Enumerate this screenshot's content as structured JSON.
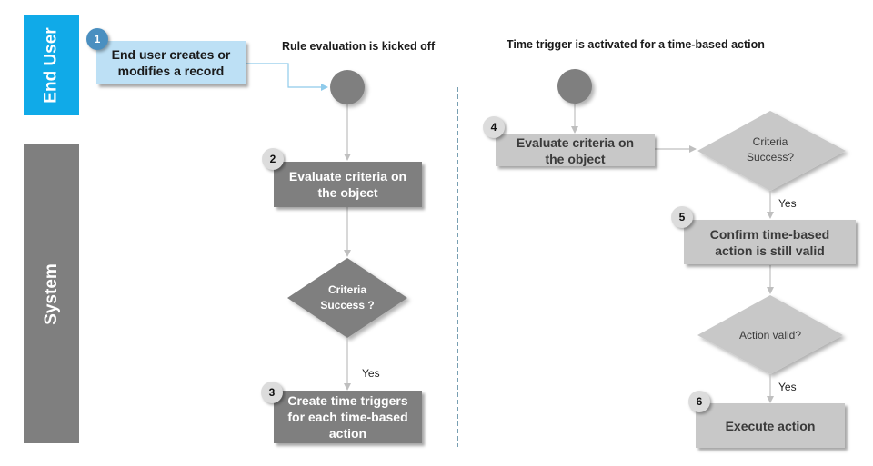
{
  "lanes": {
    "end_user": "End User",
    "system": "System"
  },
  "sections": {
    "left_title": "Rule evaluation is kicked off",
    "right_title": "Time trigger is activated for a time-based action"
  },
  "steps": [
    {
      "number": "1",
      "label": "End user creates or modifies a record"
    },
    {
      "number": "2",
      "label": "Evaluate criteria on the object"
    },
    {
      "number": "3",
      "label": "Create time triggers for each time-based action"
    },
    {
      "number": "4",
      "label": "Evaluate criteria on the object"
    },
    {
      "number": "5",
      "label": "Confirm time-based action is still valid"
    },
    {
      "number": "6",
      "label": "Execute action"
    }
  ],
  "decisions": {
    "left_criteria": "Criteria Success ?",
    "right_criteria": "Criteria Success?",
    "action_valid": "Action valid?"
  },
  "edge_labels": {
    "yes_left": "Yes",
    "yes_right_1": "Yes",
    "yes_right_2": "Yes"
  },
  "colors": {
    "end_user_lane": "#10aae8",
    "system_lane": "#7f7f7f",
    "step1_fill": "#bde0f5",
    "dark_fill": "#7f7f7f",
    "light_fill": "#c8c8c8",
    "divider": "#1f5f7f",
    "connector": "#bfbfbf",
    "blue_connector": "#8fcbeb"
  }
}
